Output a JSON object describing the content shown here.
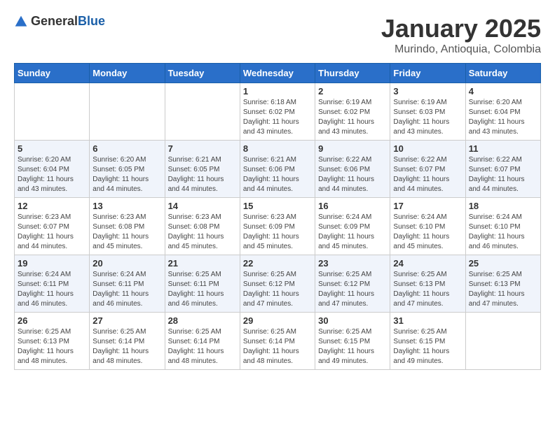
{
  "logo": {
    "text_general": "General",
    "text_blue": "Blue"
  },
  "title": "January 2025",
  "location": "Murindo, Antioquia, Colombia",
  "weekdays": [
    "Sunday",
    "Monday",
    "Tuesday",
    "Wednesday",
    "Thursday",
    "Friday",
    "Saturday"
  ],
  "weeks": [
    [
      {
        "day": "",
        "sunrise": "",
        "sunset": "",
        "daylight": ""
      },
      {
        "day": "",
        "sunrise": "",
        "sunset": "",
        "daylight": ""
      },
      {
        "day": "",
        "sunrise": "",
        "sunset": "",
        "daylight": ""
      },
      {
        "day": "1",
        "sunrise": "Sunrise: 6:18 AM",
        "sunset": "Sunset: 6:02 PM",
        "daylight": "Daylight: 11 hours and 43 minutes."
      },
      {
        "day": "2",
        "sunrise": "Sunrise: 6:19 AM",
        "sunset": "Sunset: 6:02 PM",
        "daylight": "Daylight: 11 hours and 43 minutes."
      },
      {
        "day": "3",
        "sunrise": "Sunrise: 6:19 AM",
        "sunset": "Sunset: 6:03 PM",
        "daylight": "Daylight: 11 hours and 43 minutes."
      },
      {
        "day": "4",
        "sunrise": "Sunrise: 6:20 AM",
        "sunset": "Sunset: 6:04 PM",
        "daylight": "Daylight: 11 hours and 43 minutes."
      }
    ],
    [
      {
        "day": "5",
        "sunrise": "Sunrise: 6:20 AM",
        "sunset": "Sunset: 6:04 PM",
        "daylight": "Daylight: 11 hours and 43 minutes."
      },
      {
        "day": "6",
        "sunrise": "Sunrise: 6:20 AM",
        "sunset": "Sunset: 6:05 PM",
        "daylight": "Daylight: 11 hours and 44 minutes."
      },
      {
        "day": "7",
        "sunrise": "Sunrise: 6:21 AM",
        "sunset": "Sunset: 6:05 PM",
        "daylight": "Daylight: 11 hours and 44 minutes."
      },
      {
        "day": "8",
        "sunrise": "Sunrise: 6:21 AM",
        "sunset": "Sunset: 6:06 PM",
        "daylight": "Daylight: 11 hours and 44 minutes."
      },
      {
        "day": "9",
        "sunrise": "Sunrise: 6:22 AM",
        "sunset": "Sunset: 6:06 PM",
        "daylight": "Daylight: 11 hours and 44 minutes."
      },
      {
        "day": "10",
        "sunrise": "Sunrise: 6:22 AM",
        "sunset": "Sunset: 6:07 PM",
        "daylight": "Daylight: 11 hours and 44 minutes."
      },
      {
        "day": "11",
        "sunrise": "Sunrise: 6:22 AM",
        "sunset": "Sunset: 6:07 PM",
        "daylight": "Daylight: 11 hours and 44 minutes."
      }
    ],
    [
      {
        "day": "12",
        "sunrise": "Sunrise: 6:23 AM",
        "sunset": "Sunset: 6:07 PM",
        "daylight": "Daylight: 11 hours and 44 minutes."
      },
      {
        "day": "13",
        "sunrise": "Sunrise: 6:23 AM",
        "sunset": "Sunset: 6:08 PM",
        "daylight": "Daylight: 11 hours and 45 minutes."
      },
      {
        "day": "14",
        "sunrise": "Sunrise: 6:23 AM",
        "sunset": "Sunset: 6:08 PM",
        "daylight": "Daylight: 11 hours and 45 minutes."
      },
      {
        "day": "15",
        "sunrise": "Sunrise: 6:23 AM",
        "sunset": "Sunset: 6:09 PM",
        "daylight": "Daylight: 11 hours and 45 minutes."
      },
      {
        "day": "16",
        "sunrise": "Sunrise: 6:24 AM",
        "sunset": "Sunset: 6:09 PM",
        "daylight": "Daylight: 11 hours and 45 minutes."
      },
      {
        "day": "17",
        "sunrise": "Sunrise: 6:24 AM",
        "sunset": "Sunset: 6:10 PM",
        "daylight": "Daylight: 11 hours and 45 minutes."
      },
      {
        "day": "18",
        "sunrise": "Sunrise: 6:24 AM",
        "sunset": "Sunset: 6:10 PM",
        "daylight": "Daylight: 11 hours and 46 minutes."
      }
    ],
    [
      {
        "day": "19",
        "sunrise": "Sunrise: 6:24 AM",
        "sunset": "Sunset: 6:11 PM",
        "daylight": "Daylight: 11 hours and 46 minutes."
      },
      {
        "day": "20",
        "sunrise": "Sunrise: 6:24 AM",
        "sunset": "Sunset: 6:11 PM",
        "daylight": "Daylight: 11 hours and 46 minutes."
      },
      {
        "day": "21",
        "sunrise": "Sunrise: 6:25 AM",
        "sunset": "Sunset: 6:11 PM",
        "daylight": "Daylight: 11 hours and 46 minutes."
      },
      {
        "day": "22",
        "sunrise": "Sunrise: 6:25 AM",
        "sunset": "Sunset: 6:12 PM",
        "daylight": "Daylight: 11 hours and 47 minutes."
      },
      {
        "day": "23",
        "sunrise": "Sunrise: 6:25 AM",
        "sunset": "Sunset: 6:12 PM",
        "daylight": "Daylight: 11 hours and 47 minutes."
      },
      {
        "day": "24",
        "sunrise": "Sunrise: 6:25 AM",
        "sunset": "Sunset: 6:13 PM",
        "daylight": "Daylight: 11 hours and 47 minutes."
      },
      {
        "day": "25",
        "sunrise": "Sunrise: 6:25 AM",
        "sunset": "Sunset: 6:13 PM",
        "daylight": "Daylight: 11 hours and 47 minutes."
      }
    ],
    [
      {
        "day": "26",
        "sunrise": "Sunrise: 6:25 AM",
        "sunset": "Sunset: 6:13 PM",
        "daylight": "Daylight: 11 hours and 48 minutes."
      },
      {
        "day": "27",
        "sunrise": "Sunrise: 6:25 AM",
        "sunset": "Sunset: 6:14 PM",
        "daylight": "Daylight: 11 hours and 48 minutes."
      },
      {
        "day": "28",
        "sunrise": "Sunrise: 6:25 AM",
        "sunset": "Sunset: 6:14 PM",
        "daylight": "Daylight: 11 hours and 48 minutes."
      },
      {
        "day": "29",
        "sunrise": "Sunrise: 6:25 AM",
        "sunset": "Sunset: 6:14 PM",
        "daylight": "Daylight: 11 hours and 48 minutes."
      },
      {
        "day": "30",
        "sunrise": "Sunrise: 6:25 AM",
        "sunset": "Sunset: 6:15 PM",
        "daylight": "Daylight: 11 hours and 49 minutes."
      },
      {
        "day": "31",
        "sunrise": "Sunrise: 6:25 AM",
        "sunset": "Sunset: 6:15 PM",
        "daylight": "Daylight: 11 hours and 49 minutes."
      },
      {
        "day": "",
        "sunrise": "",
        "sunset": "",
        "daylight": ""
      }
    ]
  ]
}
